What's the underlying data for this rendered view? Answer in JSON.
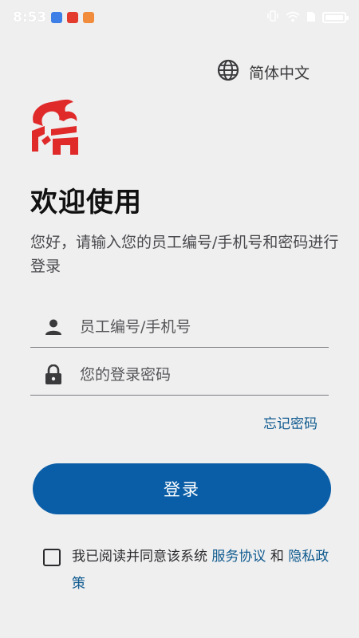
{
  "status_bar": {
    "time": "8:53"
  },
  "language": {
    "label": "简体中文"
  },
  "welcome": {
    "title": "欢迎使用",
    "subtitle": "您好，请输入您的员工编号/手机号和密码进行登录"
  },
  "form": {
    "account_placeholder": "员工编号/手机号",
    "account_value": "",
    "password_placeholder": "您的登录密码",
    "password_value": "",
    "forgot_label": "忘记密码",
    "login_label": "登录"
  },
  "agreement": {
    "checked": false,
    "prefix": "我已阅读并同意该系统",
    "service_link": "服务协议",
    "conjunction": "和",
    "privacy_link": "隐私政策"
  },
  "colors": {
    "accent": "#0a5ea7",
    "link": "#0f5a8e",
    "logo": "#e02a2a",
    "background": "#efeff0"
  },
  "icons": {
    "language": "globe-icon",
    "account": "person-icon",
    "password": "lock-icon"
  }
}
